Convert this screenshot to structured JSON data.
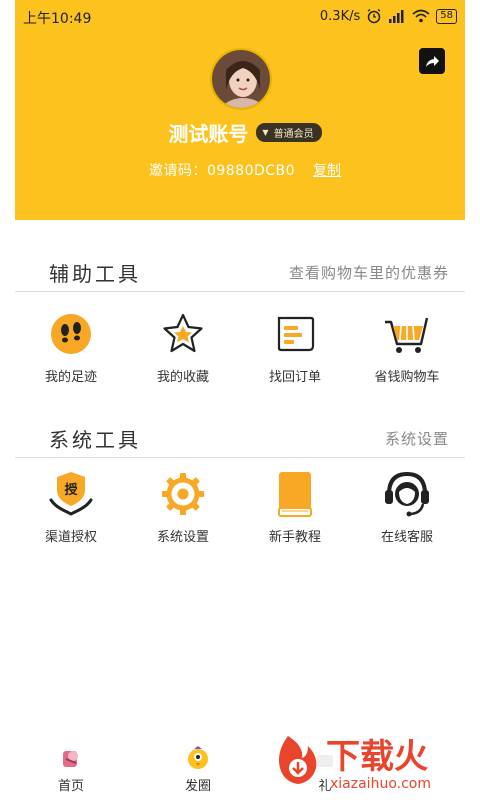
{
  "status_bar": {
    "time": "上午10:49",
    "network_speed": "0.3K/s",
    "battery": "58"
  },
  "profile": {
    "username": "测试账号",
    "member_level": "普通会员",
    "invite_label": "邀请码：",
    "invite_code": "09880DCB0",
    "copy_label": "复制"
  },
  "aux_tools": {
    "title": "辅助工具",
    "link": "查看购物车里的优惠券",
    "items": [
      {
        "label": "我的足迹",
        "icon": "footprints-icon"
      },
      {
        "label": "我的收藏",
        "icon": "star-icon"
      },
      {
        "label": "找回订单",
        "icon": "order-icon"
      },
      {
        "label": "省钱购物车",
        "icon": "cart-icon"
      }
    ]
  },
  "sys_tools": {
    "title": "系统工具",
    "link": "系统设置",
    "items": [
      {
        "label": "渠道授权",
        "icon": "authorize-icon",
        "badge": "授"
      },
      {
        "label": "系统设置",
        "icon": "gear-icon"
      },
      {
        "label": "新手教程",
        "icon": "book-icon"
      },
      {
        "label": "在线客服",
        "icon": "headset-icon"
      }
    ]
  },
  "tabbar": {
    "tabs": [
      {
        "label": "首页",
        "icon": "home-icon"
      },
      {
        "label": "发圈",
        "icon": "chick-icon"
      },
      {
        "label": "礼",
        "icon": "gift-icon"
      }
    ]
  },
  "watermark": {
    "text": "下载火",
    "url": "xiazaihuo.com"
  },
  "colors": {
    "brand_yellow": "#FCC21D",
    "icon_orange": "#F9A825",
    "watermark_red": "#E8452C"
  }
}
